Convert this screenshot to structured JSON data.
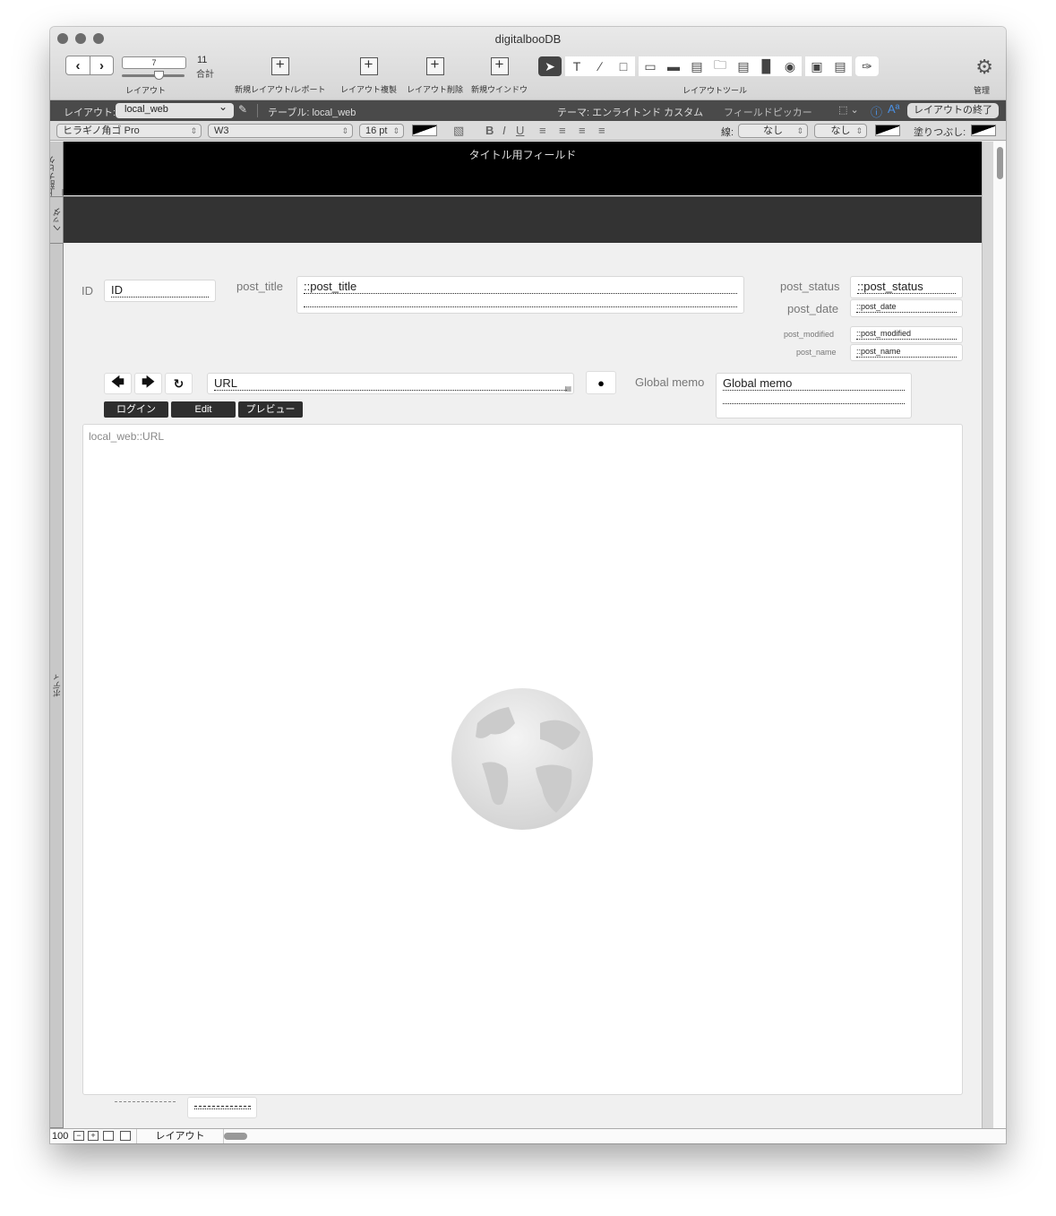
{
  "window": {
    "title": "digitalbooDB"
  },
  "toolbar": {
    "record_value": "7",
    "record_total": "11",
    "record_total_label": "合計",
    "record_label": "レイアウト",
    "buttons": [
      {
        "label": "新規レイアウト/レポート",
        "icon": "new-layout-icon"
      },
      {
        "label": "レイアウト複製",
        "icon": "duplicate-layout-icon"
      },
      {
        "label": "レイアウト削除",
        "icon": "delete-layout-icon"
      },
      {
        "label": "新規ウインドウ",
        "icon": "new-window-icon"
      }
    ],
    "tools_label": "レイアウトツール",
    "manage_label": "管理"
  },
  "layout_bar": {
    "layout_label": "レイアウト:",
    "layout_value": "local_web",
    "table_label": "テーブル: local_web",
    "theme_label": "テーマ: エンライトンド カスタム",
    "field_picker": "フィールドピッカー",
    "exit_button": "レイアウトの終了"
  },
  "format_bar": {
    "font": "ヒラギノ角ゴ Pro",
    "weight": "W3",
    "size": "16 pt",
    "line_label": "線:",
    "line_style": "なし",
    "line_width": "なし",
    "fill_label": "塗りつぶし:"
  },
  "parts": {
    "top_nav": "上部ナビゲー…",
    "header": "ヘッダ",
    "body": "ボディ"
  },
  "canvas": {
    "top_nav_title": "タイトル用フィールド",
    "fields": {
      "id_label": "ID",
      "id_value": "ID",
      "post_title_label": "post_title",
      "post_title_value": "::post_title",
      "post_status_label": "post_status",
      "post_status_value": "::post_status",
      "post_date_label": "post_date",
      "post_date_value": "::post_date",
      "post_modified_label": "post_modified",
      "post_modified_value": "::post_modified",
      "post_name_label": "post_name",
      "post_name_value": "::post_name",
      "url_value": "URL",
      "global_memo_label": "Global memo",
      "global_memo_value": "Global memo"
    },
    "buttons": {
      "login": "ログイン",
      "edit": "Edit",
      "preview": "プレビュー"
    },
    "web_viewer_label": "local_web::URL"
  },
  "status_bar": {
    "zoom": "100",
    "mode": "レイアウト"
  }
}
